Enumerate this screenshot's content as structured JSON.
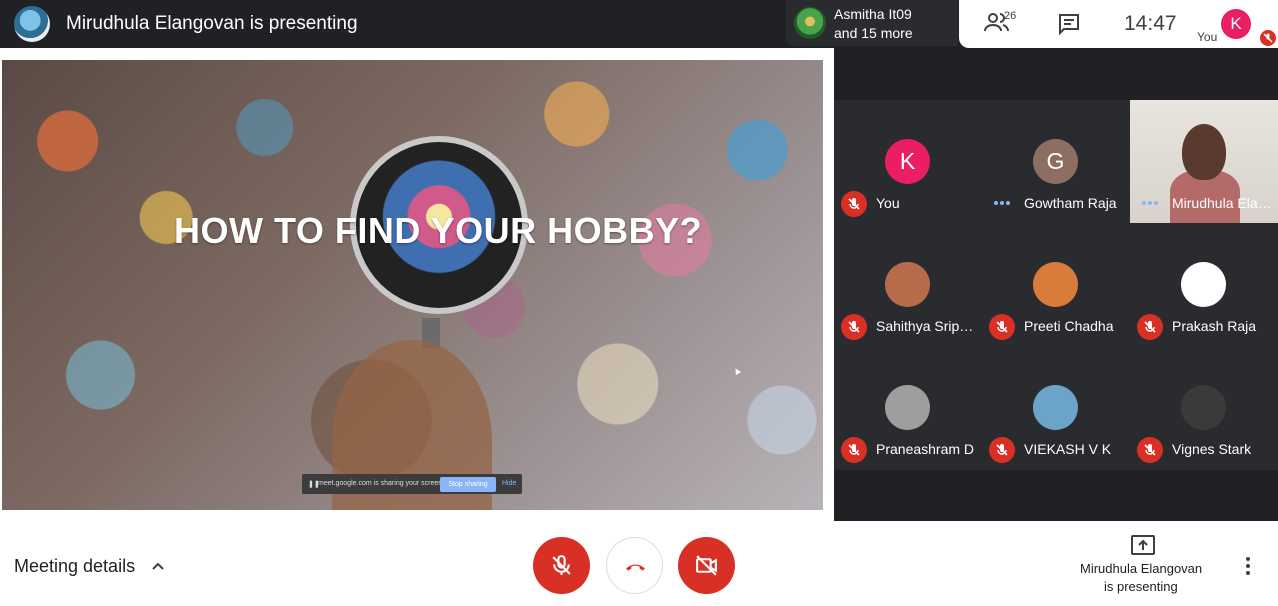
{
  "header": {
    "presenting_title": "Mirudhula Elangovan is presenting",
    "speaker_line1": "Asmitha It09",
    "speaker_line2": "and 15 more",
    "people_count": "26",
    "time": "14:47",
    "you_initial": "K",
    "you_label": "You"
  },
  "slide": {
    "heading": "HOW TO FIND YOUR HOBBY?",
    "share_message": "meet.google.com is sharing your screen.",
    "stop_sharing": "Stop sharing",
    "hide": "Hide"
  },
  "participants": [
    {
      "name": "You",
      "initial": "K",
      "color": "#e91e63",
      "status": "muted"
    },
    {
      "name": "Gowtham Raja",
      "initial": "G",
      "color": "#8d6e63",
      "status": "speaking"
    },
    {
      "name": "Mirudhula Ela…",
      "initial": "",
      "color": "",
      "status": "video"
    },
    {
      "name": "Sahithya Srip…",
      "initial": "",
      "color": "#b86b4b",
      "status": "muted"
    },
    {
      "name": "Preeti Chadha",
      "initial": "",
      "color": "#d97b3a",
      "status": "muted"
    },
    {
      "name": "Prakash Raja",
      "initial": "",
      "color": "#ffffff",
      "status": "muted"
    },
    {
      "name": "Praneashram D",
      "initial": "",
      "color": "#9e9e9e",
      "status": "muted"
    },
    {
      "name": "VIEKASH V K",
      "initial": "",
      "color": "#6ca3c9",
      "status": "muted"
    },
    {
      "name": "Vignes Stark",
      "initial": "",
      "color": "#3a3a3a",
      "status": "muted"
    }
  ],
  "bottom": {
    "meeting_details": "Meeting details",
    "presenting_line1": "Mirudhula Elangovan",
    "presenting_line2": "is presenting"
  },
  "colors": {
    "accent_red": "#d93025",
    "dark_bg": "#202124"
  }
}
